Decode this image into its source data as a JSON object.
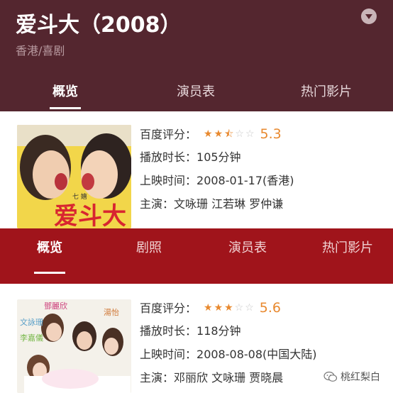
{
  "card1": {
    "title": "爱斗大（2008）",
    "subtitle": "香港/喜剧",
    "tabs": [
      "概览",
      "演员表",
      "热门影片"
    ],
    "rating_label": "百度评分：",
    "rating": "5.3",
    "rating_stars": 2.5,
    "duration_label": "播放时长：",
    "duration": "105分钟",
    "release_label": "上映时间：",
    "release": "2008-01-17(香港)",
    "cast_label": "主演：",
    "cast": "文咏珊 江若琳 罗仲谦"
  },
  "card2": {
    "tabs": [
      "概览",
      "剧照",
      "演员表",
      "热门影片"
    ],
    "rating_label": "百度评分：",
    "rating": "5.6",
    "rating_stars": 3,
    "duration_label": "播放时长：",
    "duration": "118分钟",
    "release_label": "上映时间：",
    "release": "2008-08-08(中国大陆)",
    "cast_label": "主演：",
    "cast": "邓丽欣 文咏珊 贾晓晨"
  },
  "poster_text": {
    "card1": [
      "爱斗大",
      "七 嬉"
    ],
    "card2": [
      "鄧麗欣",
      "文詠珊",
      "李嘉儀",
      "湯怡"
    ]
  },
  "watermark": "桃红梨白",
  "colors": {
    "header1_bg": "#54262f",
    "header2_bg": "#a0141b",
    "star_color": "#e8892f",
    "score_color": "#e8892f"
  },
  "icons": [
    "collapse-chevron-icon",
    "star-rating-icon",
    "wechat-icon"
  ]
}
